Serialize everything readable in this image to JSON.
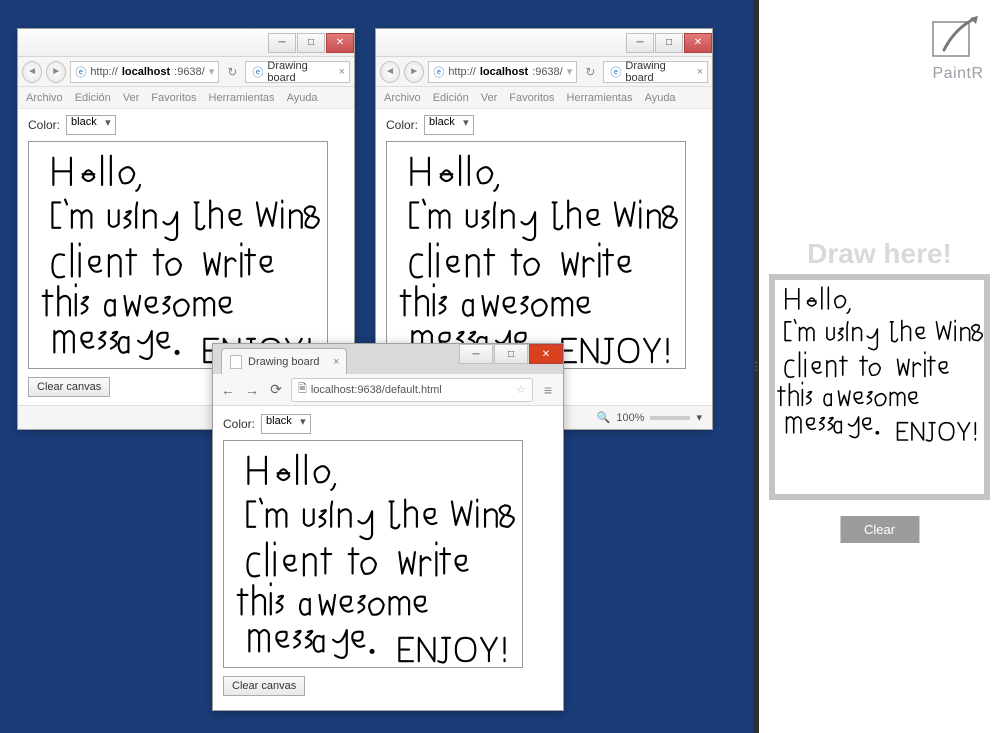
{
  "ie_window": {
    "url_prefix": "http://",
    "url_host": "localhost",
    "url_rest": ":9638/",
    "tab_title": "Drawing board",
    "menu": [
      "Archivo",
      "Edición",
      "Ver",
      "Favoritos",
      "Herramientas",
      "Ayuda"
    ],
    "color_label": "Color:",
    "color_value": "black",
    "clear_label": "Clear canvas",
    "zoom_label": "100%"
  },
  "chrome_window": {
    "tab_title": "Drawing board",
    "url": "localhost:9638/default.html",
    "color_label": "Color:",
    "color_value": "black",
    "clear_label": "Clear canvas"
  },
  "paintr": {
    "brand": "PaintR",
    "draw_here": "Draw here!",
    "clear_label": "Clear"
  },
  "handwriting_text": "Hello,\nI'm using the Win8\nclient to write\nthis awesome\nmessage.\nENJOY!",
  "colors": {
    "desktop": "#1a3d7a",
    "paintr_border": "#c4c4c4",
    "paintr_clear": "#9c9c9c"
  }
}
